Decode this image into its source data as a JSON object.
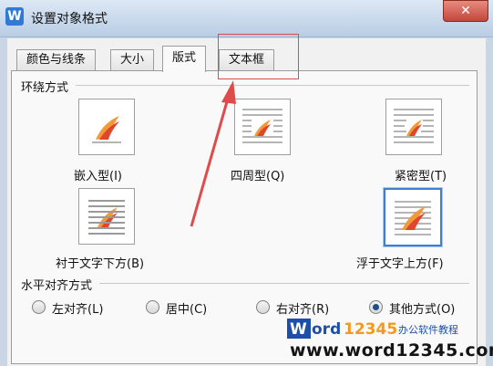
{
  "window": {
    "app_icon": "W",
    "title": "设置对象格式",
    "close_glyph": "✕"
  },
  "tabs": [
    {
      "label": "颜色与线条"
    },
    {
      "label": "大小"
    },
    {
      "label": "版式"
    },
    {
      "label": "文本框"
    }
  ],
  "active_tab": "版式",
  "wrap_section": {
    "title": "环绕方式",
    "options": [
      {
        "label": "嵌入型(I)",
        "icon": "inline-icon"
      },
      {
        "label": "四周型(Q)",
        "icon": "square-wrap-icon"
      },
      {
        "label": "紧密型(T)",
        "icon": "tight-wrap-icon"
      },
      {
        "label": "衬于文字下方(B)",
        "icon": "behind-text-icon"
      },
      {
        "label": "浮于文字上方(F)",
        "icon": "in-front-of-text-icon",
        "selected": true
      }
    ]
  },
  "align_section": {
    "title": "水平对齐方式",
    "options": [
      {
        "label": "左对齐(L)",
        "selected": false
      },
      {
        "label": "居中(C)",
        "selected": false
      },
      {
        "label": "右对齐(R)",
        "selected": false
      },
      {
        "label": "其他方式(O)",
        "selected": true
      }
    ]
  },
  "watermark": {
    "logo_word": "Word",
    "logo_digits": "12345",
    "logo_tagline": "办公软件教程",
    "url": "www.word12345.com"
  },
  "colors": {
    "annotation_red": "#e04a4a",
    "selected_blue": "#3d7fd1",
    "logo_blue": "#1e4fa8",
    "logo_orange": "#f39a1e"
  }
}
